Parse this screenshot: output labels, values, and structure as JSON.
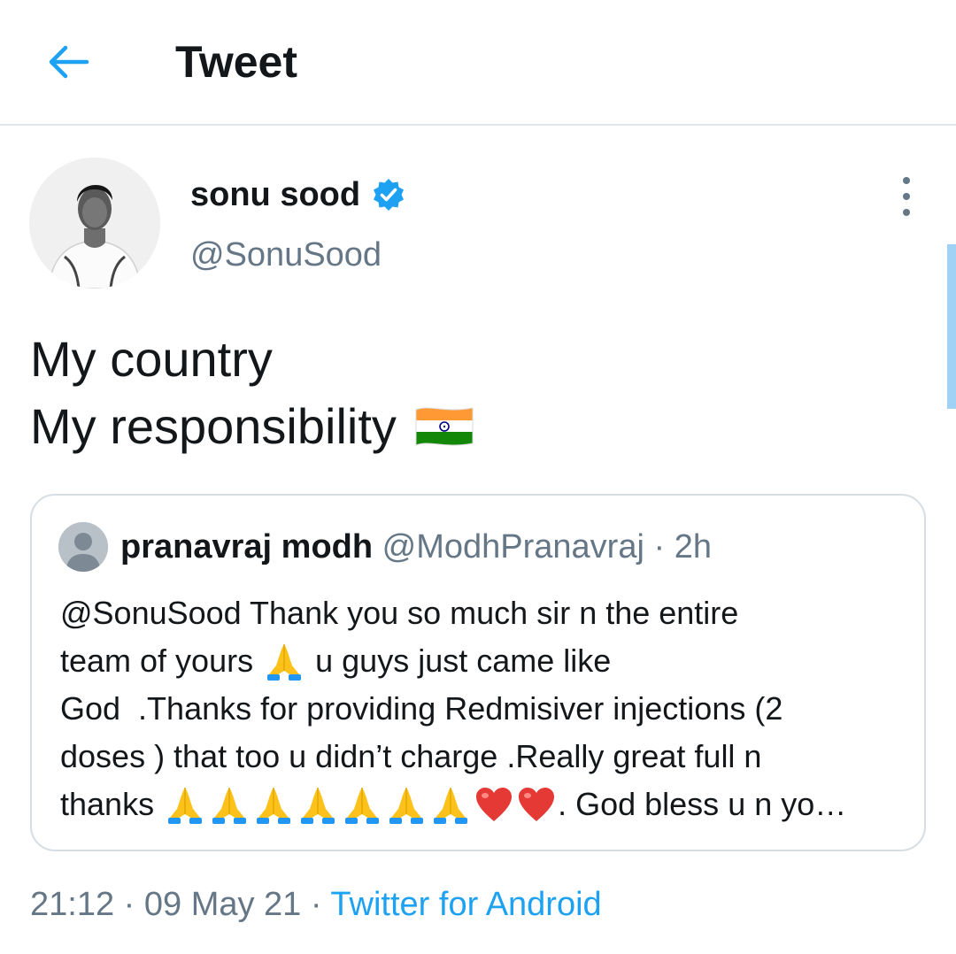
{
  "header": {
    "title": "Tweet",
    "back_icon": "arrow-left-icon",
    "accent_color": "#1da1f2"
  },
  "author": {
    "name": "sonu sood",
    "handle": "@SonuSood",
    "verified_icon": "verified-badge-icon"
  },
  "tweet": {
    "line1": "My country",
    "line2": "My responsibility",
    "emoji": "india-flag-icon"
  },
  "quote": {
    "name": "pranavraj modh",
    "handle": "@ModhPranavraj",
    "separator": "·",
    "time": "2h",
    "lines": [
      "@SonuSood Thank you so much sir n the entire",
      "team of yours",
      "u guys just came like",
      "God  .Thanks for providing Redmisiver injections (2",
      "doses ) that too u didn’t charge .Really great full n",
      "thanks",
      ". God bless u n yo…"
    ]
  },
  "meta": {
    "time": "21:12",
    "separator1": "·",
    "date": "09 May 21",
    "separator2": "·",
    "source": "Twitter for Android"
  }
}
